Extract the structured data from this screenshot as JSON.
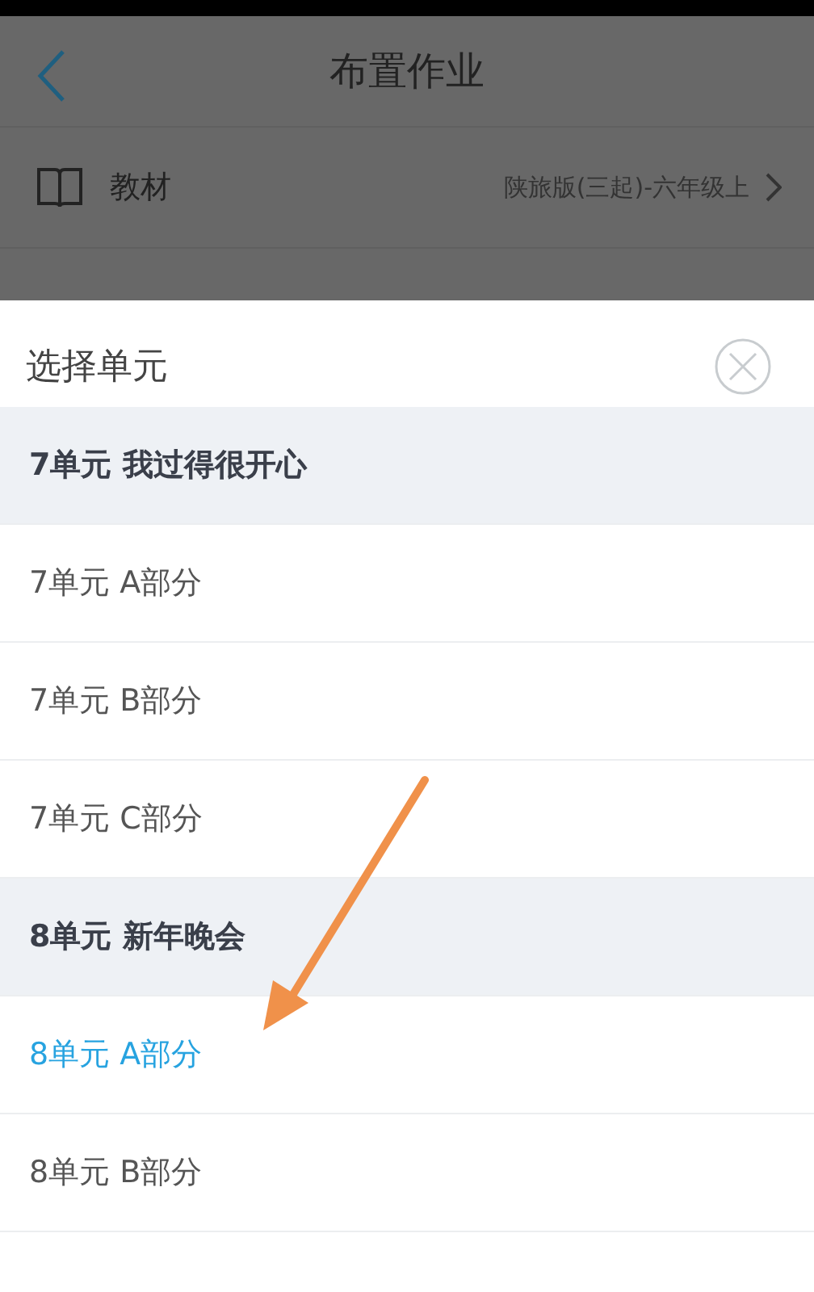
{
  "header": {
    "title": "布置作业"
  },
  "settings": [
    {
      "label": "教材",
      "value": "陕旅版(三起)-六年级上"
    }
  ],
  "sheet": {
    "title": "选择单元",
    "rows": [
      {
        "kind": "group",
        "label": "7单元 我过得很开心",
        "selected": false
      },
      {
        "kind": "item",
        "label": "7单元 A部分",
        "selected": false
      },
      {
        "kind": "item",
        "label": "7单元 B部分",
        "selected": false
      },
      {
        "kind": "item",
        "label": "7单元 C部分",
        "selected": false
      },
      {
        "kind": "group",
        "label": "8单元 新年晚会",
        "selected": false
      },
      {
        "kind": "item",
        "label": "8单元 A部分",
        "selected": true
      },
      {
        "kind": "item",
        "label": "8单元 B部分",
        "selected": false
      }
    ]
  }
}
